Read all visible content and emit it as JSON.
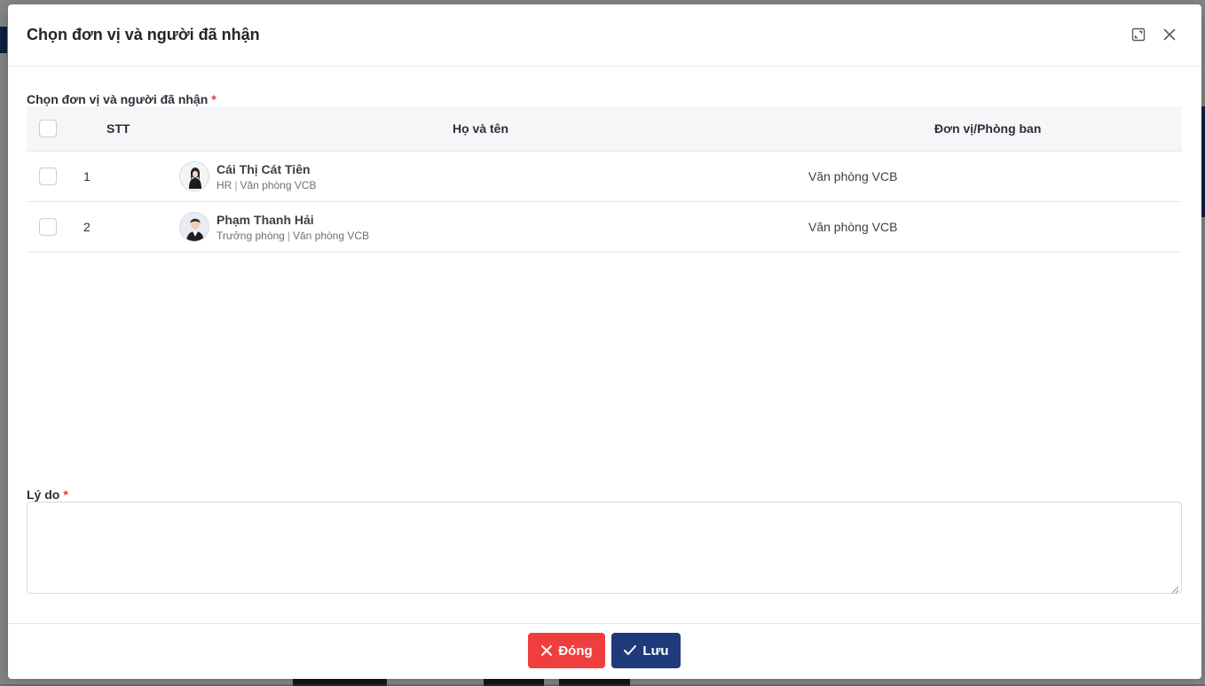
{
  "modal": {
    "title": "Chọn đơn vị và người đã nhận",
    "recipients_label": "Chọn đơn vị và người đã nhận",
    "reason_label": "Lý do",
    "required_mark": "*",
    "reason_value": "",
    "reason_placeholder": ""
  },
  "table": {
    "columns": [
      "STT",
      "Họ và tên",
      "Đơn vị/Phòng ban"
    ],
    "rows": [
      {
        "stt": "1",
        "name": "Cái Thị Cát Tiên",
        "role": "HR",
        "department": "Văn phòng VCB",
        "unit": "Văn phòng VCB",
        "checked": false
      },
      {
        "stt": "2",
        "name": "Phạm Thanh Hải",
        "role": "Trưởng phòng",
        "department": "Văn phòng VCB",
        "unit": "Văn phòng VCB",
        "checked": false
      }
    ]
  },
  "footer": {
    "close_label": "Đóng",
    "save_label": "Lưu"
  },
  "colors": {
    "close_button": "#ef3e3e",
    "save_button": "#1f3a7a",
    "required": "#e53935"
  },
  "icons": {
    "expand": "expand-icon",
    "close": "close-icon",
    "x": "x-icon",
    "check": "check-icon"
  }
}
